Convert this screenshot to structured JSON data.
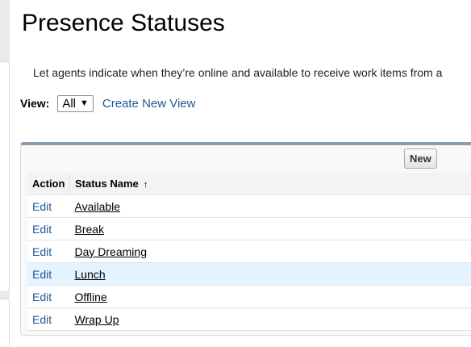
{
  "page": {
    "title": "Presence Statuses",
    "description": "Let agents indicate when they’re online and available to receive work items from a"
  },
  "view": {
    "label": "View:",
    "selected": "All",
    "create_link": "Create New View"
  },
  "list": {
    "new_button": "New",
    "columns": {
      "action": "Action",
      "status_name": "Status Name",
      "sort_icon": "↑"
    },
    "rows": [
      {
        "action": "Edit",
        "name": "Available"
      },
      {
        "action": "Edit",
        "name": "Break"
      },
      {
        "action": "Edit",
        "name": "Day Dreaming"
      },
      {
        "action": "Edit",
        "name": "Lunch"
      },
      {
        "action": "Edit",
        "name": "Offline"
      },
      {
        "action": "Edit",
        "name": "Wrap Up"
      }
    ]
  }
}
